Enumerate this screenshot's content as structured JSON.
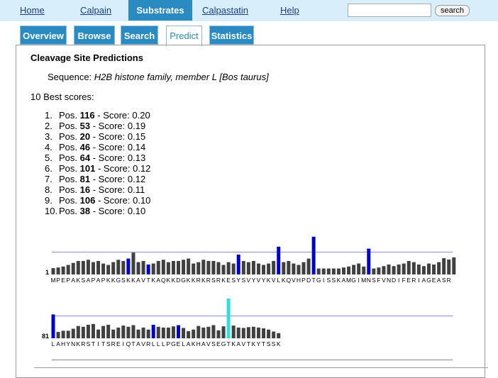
{
  "nav": {
    "items": [
      "Home",
      "Calpain",
      "Substrates",
      "Calpastatin",
      "Help"
    ],
    "active": "Substrates",
    "search_placeholder": "",
    "search_button": "search"
  },
  "tabs": [
    "Overview",
    "Browse",
    "Search",
    "Predict",
    "Statistics"
  ],
  "active_tab": "Predict",
  "main": {
    "title": "Cleavage Site Predictions",
    "sequence_label": "Sequence:",
    "sequence_name": "H2B histone family, member L [Bos taurus]",
    "best_label": "10 Best scores:",
    "pos_label": "Pos.",
    "score_label": "- Score:",
    "scores": [
      {
        "rank": "1.",
        "pos": "116",
        "score": "0.20"
      },
      {
        "rank": "2.",
        "pos": "53",
        "score": "0.19"
      },
      {
        "rank": "3.",
        "pos": "20",
        "score": "0.15"
      },
      {
        "rank": "4.",
        "pos": "46",
        "score": "0.14"
      },
      {
        "rank": "5.",
        "pos": "64",
        "score": "0.13"
      },
      {
        "rank": "6.",
        "pos": "101",
        "score": "0.12"
      },
      {
        "rank": "7.",
        "pos": "81",
        "score": "0.12"
      },
      {
        "rank": "8.",
        "pos": "16",
        "score": "0.11"
      },
      {
        "rank": "9.",
        "pos": "106",
        "score": "0.10"
      },
      {
        "rank": "10.",
        "pos": "38",
        "score": "0.10"
      }
    ]
  },
  "colors": {
    "nav_bg": "#d8eefa",
    "accent": "#2a8bc3",
    "bar": "#404040",
    "highlight": "#0000cc",
    "top_highlight": "#33dddd",
    "threshold": "#6666cc"
  },
  "chart_data": {
    "type": "bar",
    "rows": [
      {
        "start_label": "1",
        "start": 1,
        "residues": "MPEPAKSAPAPKKGSKKAVTKAQKKDGKKRKRSRKESYSVYVYKVLKQVHPDTGISSKAMGIMNSFVNDIFERIAGEASR",
        "values": [
          0.032,
          0.035,
          0.04,
          0.048,
          0.058,
          0.068,
          0.068,
          0.074,
          0.062,
          0.068,
          0.055,
          0.048,
          0.062,
          0.074,
          0.068,
          0.08,
          0.11,
          0.062,
          0.068,
          0.05,
          0.055,
          0.068,
          0.074,
          0.062,
          0.068,
          0.068,
          0.074,
          0.08,
          0.055,
          0.062,
          0.074,
          0.068,
          0.068,
          0.062,
          0.048,
          0.062,
          0.055,
          0.1,
          0.068,
          0.062,
          0.068,
          0.055,
          0.048,
          0.055,
          0.068,
          0.14,
          0.062,
          0.068,
          0.055,
          0.048,
          0.062,
          0.08,
          0.19,
          0.03,
          0.03,
          0.03,
          0.03,
          0.03,
          0.035,
          0.04,
          0.048,
          0.055,
          0.04,
          0.13,
          0.03,
          0.035,
          0.042,
          0.05,
          0.042,
          0.05,
          0.055,
          0.068,
          0.062,
          0.05,
          0.042,
          0.055,
          0.05,
          0.062,
          0.082,
          0.075,
          0.086
        ],
        "highlighted": [
          16,
          20,
          38,
          46,
          53,
          64
        ]
      },
      {
        "start_label": "81",
        "start": 81,
        "residues": "LAHYNKRSTITSREIQTAVRLLLPGELAKHAVSEGTKAVTKYTSSK",
        "values": [
          0.12,
          0.032,
          0.038,
          0.038,
          0.048,
          0.062,
          0.058,
          0.068,
          0.072,
          0.044,
          0.062,
          0.068,
          0.044,
          0.054,
          0.064,
          0.058,
          0.066,
          0.044,
          0.054,
          0.044,
          0.068,
          0.058,
          0.054,
          0.054,
          0.06,
          0.066,
          0.052,
          0.036,
          0.044,
          0.062,
          0.054,
          0.058,
          0.066,
          0.04,
          0.06,
          0.2,
          0.064,
          0.054,
          0.052,
          0.056,
          0.058,
          0.054,
          0.05,
          0.044,
          0.034,
          0.026
        ],
        "highlighted": [
          81,
          101,
          106
        ],
        "top_highlighted": [
          116
        ]
      }
    ],
    "threshold": 0.1,
    "ylim": [
      0,
      0.2
    ]
  }
}
